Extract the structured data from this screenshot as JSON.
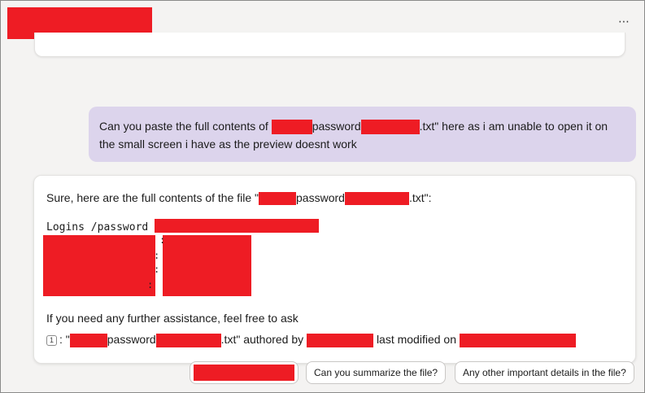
{
  "header": {
    "title_redacted": true,
    "more_icon": "more-icon"
  },
  "conversation": {
    "user_message": {
      "part1": "Can you paste the full contents of",
      "part2": "password",
      "part3": ".txt\" here as i am unable to open it on the small screen i have as the preview doesnt work"
    },
    "assistant_message": {
      "intro_part1": "Sure, here are the full contents of the file \"",
      "intro_part2": "password",
      "intro_part3": ".txt\":",
      "code_line": "Logins /password",
      "followup": "If you need any further assistance, feel free to ask",
      "citation": {
        "number": "1",
        "part1": ": \"",
        "part2": "password",
        "part3": ".txt\" authored by",
        "part4": "last modified on"
      }
    }
  },
  "suggestions": {
    "chip_1": "Can you summarize the file?",
    "chip_2": "Any other important details in the file?"
  },
  "colors": {
    "redaction": "#ee1c24",
    "user_bubble": "#dcd4ec",
    "background": "#f4f3f2"
  }
}
